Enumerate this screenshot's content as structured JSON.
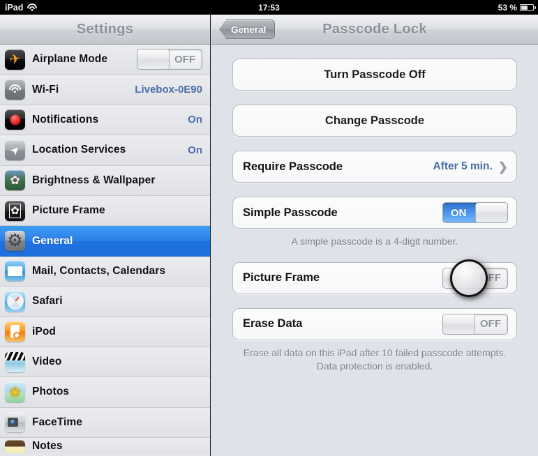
{
  "status_bar": {
    "device": "iPad",
    "wifi_icon": "wifi-icon",
    "time": "17:53",
    "battery_percent": "53 %",
    "battery_icon": "battery-icon"
  },
  "sidebar": {
    "title": "Settings",
    "items": [
      {
        "label": "Airplane Mode",
        "icon": "airplane-icon",
        "control": "toggle",
        "toggle_state": "OFF"
      },
      {
        "label": "Wi-Fi",
        "icon": "wifi-icon",
        "value": "Livebox-0E90"
      },
      {
        "label": "Notifications",
        "icon": "notifications-icon",
        "value": "On"
      },
      {
        "label": "Location Services",
        "icon": "location-arrow-icon",
        "value": "On"
      },
      {
        "label": "Brightness & Wallpaper",
        "icon": "flower-wallpaper-icon",
        "value": ""
      },
      {
        "label": "Picture Frame",
        "icon": "picture-frame-icon",
        "value": ""
      },
      {
        "label": "General",
        "icon": "gear-icon",
        "value": "",
        "selected": true
      },
      {
        "label": "Mail, Contacts, Calendars",
        "icon": "mail-icon",
        "value": ""
      },
      {
        "label": "Safari",
        "icon": "safari-compass-icon",
        "value": ""
      },
      {
        "label": "iPod",
        "icon": "ipod-icon",
        "value": ""
      },
      {
        "label": "Video",
        "icon": "video-clapperboard-icon",
        "value": ""
      },
      {
        "label": "Photos",
        "icon": "photos-flower-icon",
        "value": ""
      },
      {
        "label": "FaceTime",
        "icon": "facetime-camera-icon",
        "value": ""
      },
      {
        "label": "Notes",
        "icon": "notes-icon",
        "value": "",
        "partial": true
      }
    ]
  },
  "panel": {
    "back_button": "General",
    "title": "Passcode Lock",
    "turn_passcode_off": "Turn Passcode Off",
    "change_passcode": "Change Passcode",
    "require_passcode": {
      "label": "Require Passcode",
      "value": "After 5 min.",
      "chevron": "chevron-right-icon"
    },
    "simple_passcode": {
      "label": "Simple Passcode",
      "toggle_state": "ON"
    },
    "simple_passcode_hint": "A simple passcode is a 4-digit number.",
    "picture_frame": {
      "label": "Picture Frame",
      "toggle_state": "OFF"
    },
    "erase_data": {
      "label": "Erase Data",
      "toggle_state": "OFF"
    },
    "erase_data_hint": "Erase all data on this iPad after 10 failed passcode attempts.  Data protection is enabled."
  },
  "colors": {
    "selection_blue": "#2b7fe8",
    "toggle_on_blue": "#4e9af0",
    "value_blue": "#4a6ea8",
    "panel_background": "#dfe2e8"
  }
}
